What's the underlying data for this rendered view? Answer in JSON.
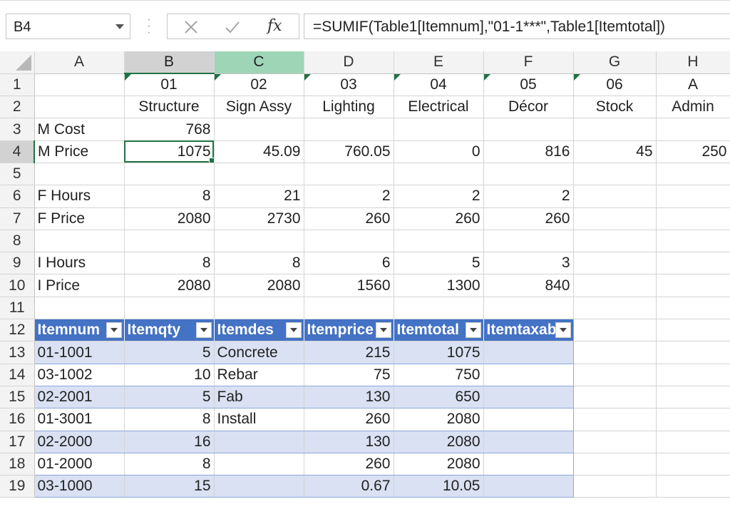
{
  "name_box": {
    "value": "B4"
  },
  "formula_bar": {
    "formula": "=SUMIF(Table1[Itemnum],\"01-1***\",Table1[Itemtotal])",
    "cancel_icon": "x-icon",
    "enter_icon": "check-icon",
    "insert_function_label": "fx"
  },
  "colors": {
    "selection": "#217346",
    "table_header": "#4472c4",
    "table_band": "#d9e1f2",
    "highlight_header": "#9fd5b7"
  },
  "active_cell": "B4",
  "columns": [
    "A",
    "B",
    "C",
    "D",
    "E",
    "F",
    "G",
    "H"
  ],
  "rows": {
    "r1": [
      "",
      "01",
      "02",
      "03",
      "04",
      "05",
      "06",
      "A"
    ],
    "r2": [
      "",
      "Structure",
      "Sign Assy",
      "Lighting",
      "Electrical",
      "Décor",
      "Stock",
      "Admin"
    ],
    "r3": [
      "M Cost",
      "768",
      "",
      "",
      "",
      "",
      "",
      ""
    ],
    "r4": [
      "M Price",
      "1075",
      "45.09",
      "760.05",
      "0",
      "816",
      "45",
      "250"
    ],
    "r5": [
      "",
      "",
      "",
      "",
      "",
      "",
      "",
      ""
    ],
    "r6": [
      "F Hours",
      "8",
      "21",
      "2",
      "2",
      "2",
      "",
      ""
    ],
    "r7": [
      "F Price",
      "2080",
      "2730",
      "260",
      "260",
      "260",
      "",
      ""
    ],
    "r8": [
      "",
      "",
      "",
      "",
      "",
      "",
      "",
      ""
    ],
    "r9": [
      "I Hours",
      "8",
      "8",
      "6",
      "5",
      "3",
      "",
      ""
    ],
    "r10": [
      "I Price",
      "2080",
      "2080",
      "1560",
      "1300",
      "840",
      "",
      ""
    ],
    "r11": [
      "",
      "",
      "",
      "",
      "",
      "",
      "",
      ""
    ]
  },
  "table": {
    "headers": [
      "Itemnum",
      "Itemqty",
      "Itemdes",
      "Itemprice",
      "Itemtotal",
      "Itemtaxable"
    ],
    "rows": [
      [
        "01-1001",
        "5",
        "Concrete",
        "215",
        "1075",
        ""
      ],
      [
        "03-1002",
        "10",
        "Rebar",
        "75",
        "750",
        ""
      ],
      [
        "02-2001",
        "5",
        "Fab",
        "130",
        "650",
        ""
      ],
      [
        "01-3001",
        "8",
        "Install",
        "260",
        "2080",
        ""
      ],
      [
        "02-2000",
        "16",
        "",
        "130",
        "2080",
        ""
      ],
      [
        "01-2000",
        "8",
        "",
        "260",
        "2080",
        ""
      ],
      [
        "03-1000",
        "15",
        "",
        "0.67",
        "10.05",
        ""
      ]
    ]
  }
}
